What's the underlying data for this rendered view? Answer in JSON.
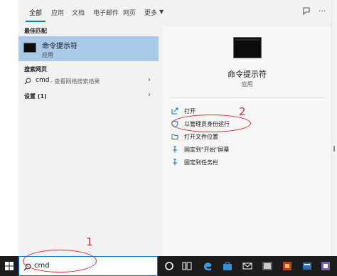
{
  "tabs": [
    {
      "label": "全部",
      "active": true
    },
    {
      "label": "应用",
      "active": false
    },
    {
      "label": "文档",
      "active": false
    },
    {
      "label": "电子邮件",
      "active": false
    },
    {
      "label": "网页",
      "active": false
    },
    {
      "label": "更多",
      "active": false
    }
  ],
  "header": {
    "overflow": "···"
  },
  "left": {
    "best_match_label": "最佳匹配",
    "best_match": {
      "title": "命令提示符",
      "subtitle": "应用"
    },
    "web_label": "搜索网页",
    "web_query": "cmd",
    "web_hint": "- 查看网络搜索结果",
    "settings_label": "设置 (1)",
    "arrow": "›"
  },
  "preview": {
    "title": "命令提示符",
    "subtitle": "应用",
    "actions": [
      {
        "label": "打开",
        "icon": "open-icon"
      },
      {
        "label": "以管理员身份运行",
        "icon": "shield-icon"
      },
      {
        "label": "打开文件位置",
        "icon": "folder-icon"
      },
      {
        "label": "固定到\"开始\"屏幕",
        "icon": "pin-icon"
      },
      {
        "label": "固定到任务栏",
        "icon": "pin-icon"
      }
    ]
  },
  "annotations": {
    "one": "1",
    "two": "2",
    "color": "#e3282d"
  },
  "taskbar": {
    "search_value": "cmd",
    "icons": [
      "windows-logo-icon",
      "task-view-icon",
      "file-explorer-icon",
      "edge-icon",
      "store-icon",
      "mail-icon",
      "terminal-icon",
      "app-icon",
      "app-icon",
      "app-icon"
    ]
  },
  "colors": {
    "accent": "#0078d7",
    "selected_row": "#aac9e8",
    "taskbar": "#1c1c1c"
  }
}
